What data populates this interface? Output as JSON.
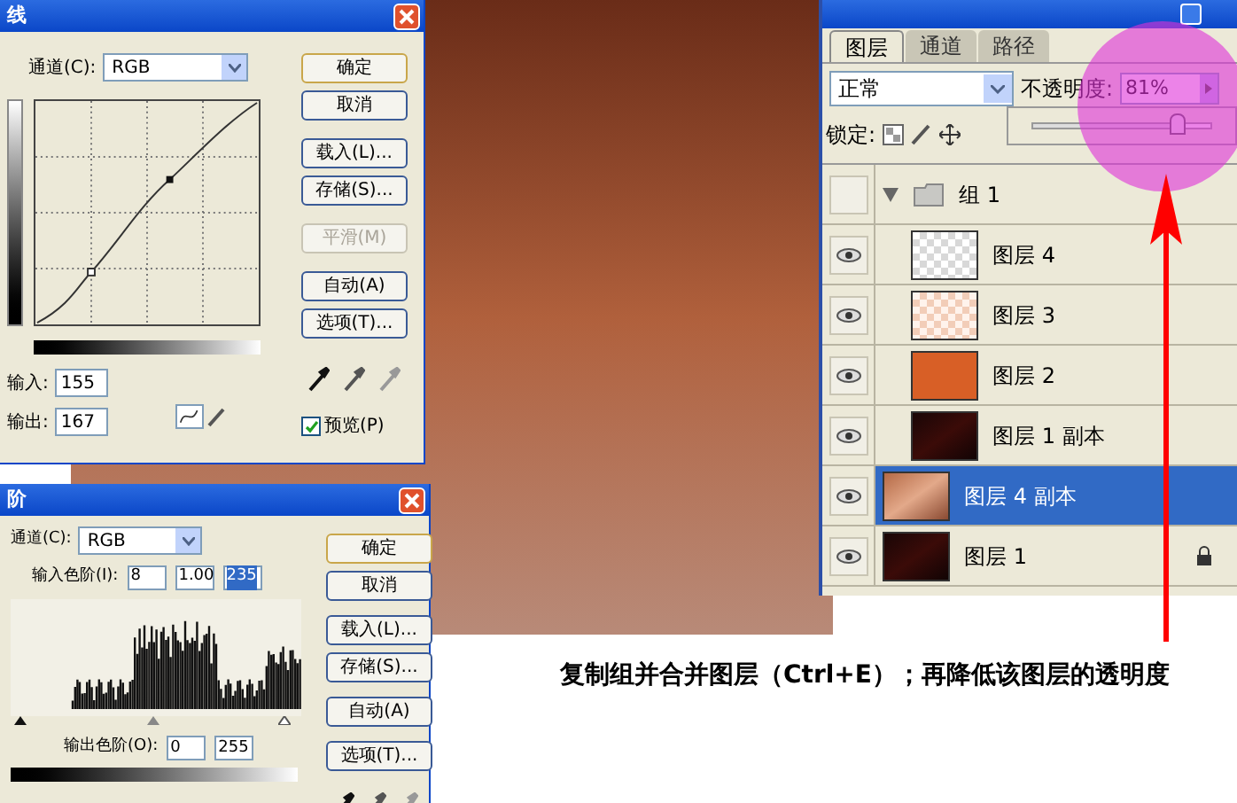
{
  "curves_dialog": {
    "title": "线",
    "channel_label": "通道(C):",
    "channel": "RGB",
    "input_label": "输入:",
    "input": "155",
    "output_label": "输出:",
    "output": "167",
    "buttons": [
      {
        "label": "确定",
        "default": true,
        "disabled": false
      },
      {
        "label": "取消",
        "default": false,
        "disabled": false
      },
      {
        "label": "载入(L)...",
        "default": false,
        "disabled": false
      },
      {
        "label": "存储(S)...",
        "default": false,
        "disabled": false
      },
      {
        "label": "平滑(M)",
        "default": false,
        "disabled": true
      },
      {
        "label": "自动(A)",
        "default": false,
        "disabled": false
      },
      {
        "label": "选项(T)...",
        "default": false,
        "disabled": false
      }
    ],
    "preview": {
      "label": "预览(P)",
      "checked": true
    }
  },
  "levels_dialog": {
    "title": "阶",
    "channel_label": "通道(C):",
    "channel": "RGB",
    "input_label": "输入色阶(I):",
    "inputs": [
      {
        "value": "8",
        "selected": false
      },
      {
        "value": "1.00",
        "selected": false
      },
      {
        "value": "235",
        "selected": true
      }
    ],
    "output_label": "输出色阶(O):",
    "outputs": [
      "0",
      "255"
    ],
    "buttons": [
      {
        "label": "确定",
        "default": true
      },
      {
        "label": "取消",
        "default": false
      },
      {
        "label": "载入(L)...",
        "default": false
      },
      {
        "label": "存储(S)...",
        "default": false
      },
      {
        "label": "自动(A)",
        "default": false
      },
      {
        "label": "选项(T)...",
        "default": false
      }
    ]
  },
  "layers_panel": {
    "tabs": [
      {
        "label": "图层",
        "selected": true
      },
      {
        "label": "通道",
        "selected": false
      },
      {
        "label": "路径",
        "selected": false
      }
    ],
    "blend_mode": "正常",
    "opacity_label": "不透明度:",
    "opacity": "81%",
    "opacity_slider": {
      "level": 0.81
    },
    "lock_label": "锁定:",
    "layers": [
      {
        "name": "组 1",
        "kind": "group",
        "visible": false,
        "expanded": true,
        "selected": false,
        "locked": false,
        "children": [
          {
            "name": "图层 4",
            "kind": "transparent",
            "visible": true,
            "selected": false,
            "locked": false
          },
          {
            "name": "图层 3",
            "kind": "peach",
            "visible": true,
            "selected": false,
            "locked": false
          },
          {
            "name": "图层 2",
            "kind": "fill",
            "visible": true,
            "selected": false,
            "locked": false
          },
          {
            "name": "图层 1 副本",
            "kind": "dark",
            "visible": true,
            "selected": false,
            "locked": false
          }
        ]
      },
      {
        "name": "图层 4 副本",
        "kind": "photo",
        "visible": true,
        "selected": true,
        "locked": false
      },
      {
        "name": "图层 1",
        "kind": "dark",
        "visible": true,
        "selected": false,
        "locked": true
      }
    ]
  },
  "caption": "复制组并合并图层（Ctrl+E）；再降低该图层的透明度"
}
